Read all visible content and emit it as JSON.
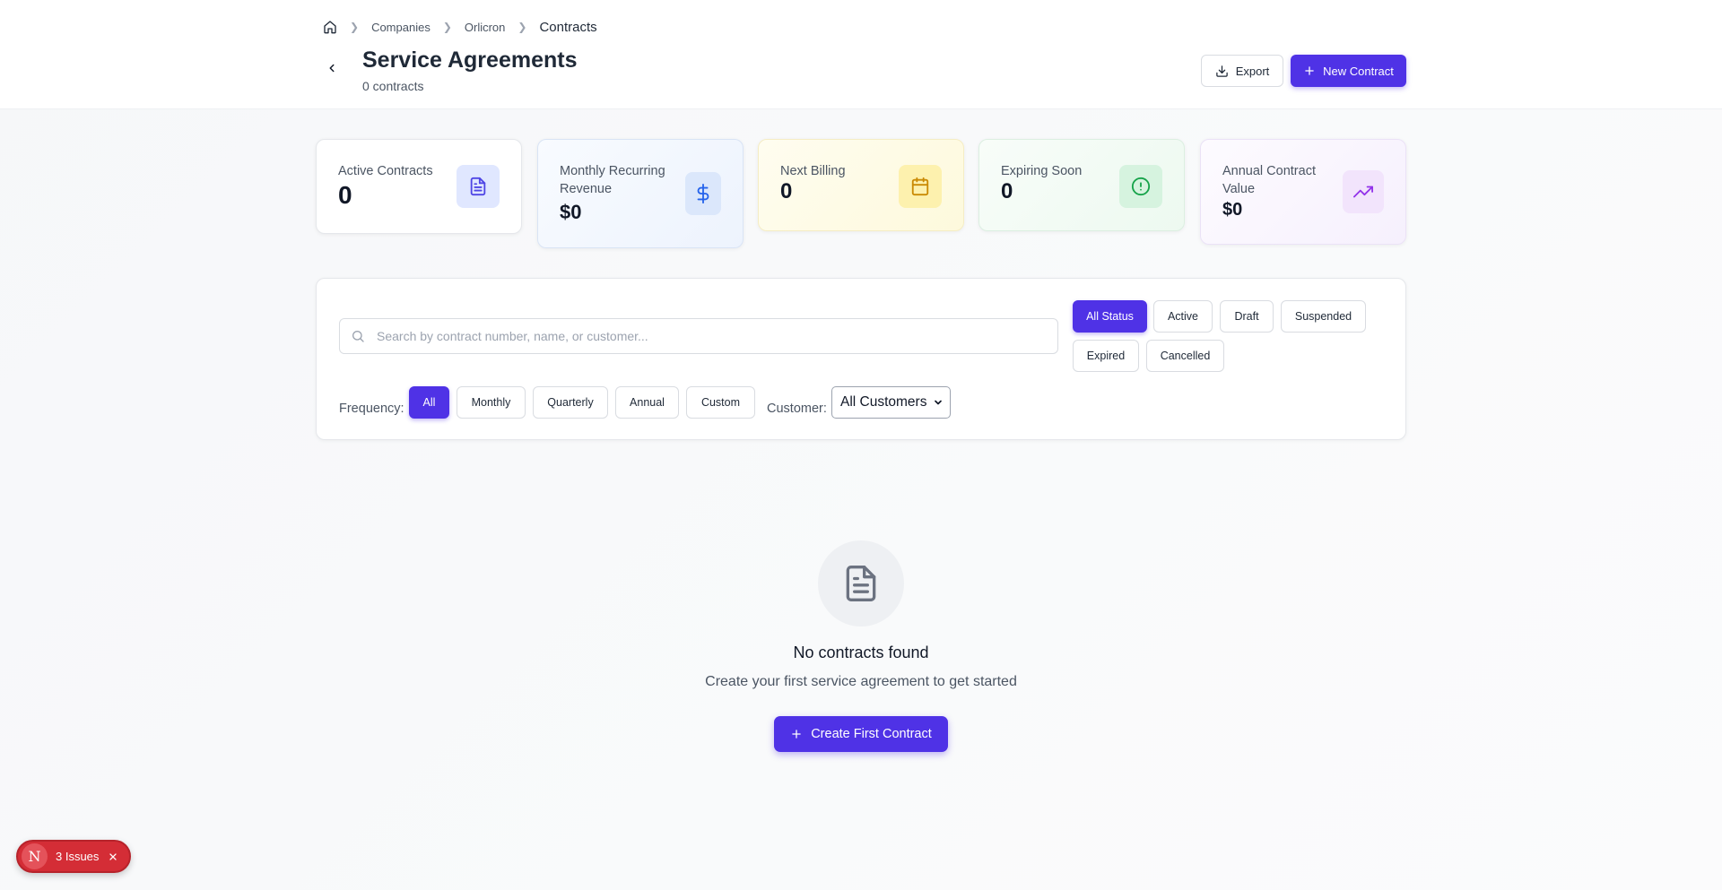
{
  "breadcrumb": {
    "items": [
      "Companies",
      "Orlicron",
      "Contracts"
    ]
  },
  "header": {
    "title": "Service Agreements",
    "subtitle": "0 contracts",
    "export_label": "Export",
    "new_label": "New Contract"
  },
  "stats": [
    {
      "label": "Active Contracts",
      "value": "0",
      "icon": "document-icon",
      "color": "#4f46e5"
    },
    {
      "label": "Monthly Recurring Revenue",
      "value": "$0",
      "icon": "dollar-icon",
      "color": "#2563eb"
    },
    {
      "label": "Next Billing",
      "value": "0",
      "icon": "calendar-icon",
      "color": "#ca8a04"
    },
    {
      "label": "Expiring Soon",
      "value": "0",
      "icon": "alert-circle-icon",
      "color": "#16a34a"
    },
    {
      "label": "Annual Contract Value",
      "value": "$0",
      "icon": "trending-up-icon",
      "color": "#9333ea"
    }
  ],
  "filters": {
    "search_placeholder": "Search by contract number, name, or customer...",
    "status": [
      "All Status",
      "Active",
      "Draft",
      "Suspended",
      "Expired",
      "Cancelled"
    ],
    "status_selected": "All Status",
    "frequency_label": "Frequency:",
    "frequency": [
      "All",
      "Monthly",
      "Quarterly",
      "Annual",
      "Custom"
    ],
    "frequency_selected": "All",
    "customer_label": "Customer:",
    "customer_value": "All Customers"
  },
  "empty": {
    "title": "No contracts found",
    "subtitle": "Create your first service agreement to get started",
    "button_label": "Create First Contract"
  },
  "issues": {
    "logo": "N",
    "label": "3 Issues"
  },
  "colors": {
    "accent": "#4f32e6",
    "danger": "#d42d36"
  }
}
